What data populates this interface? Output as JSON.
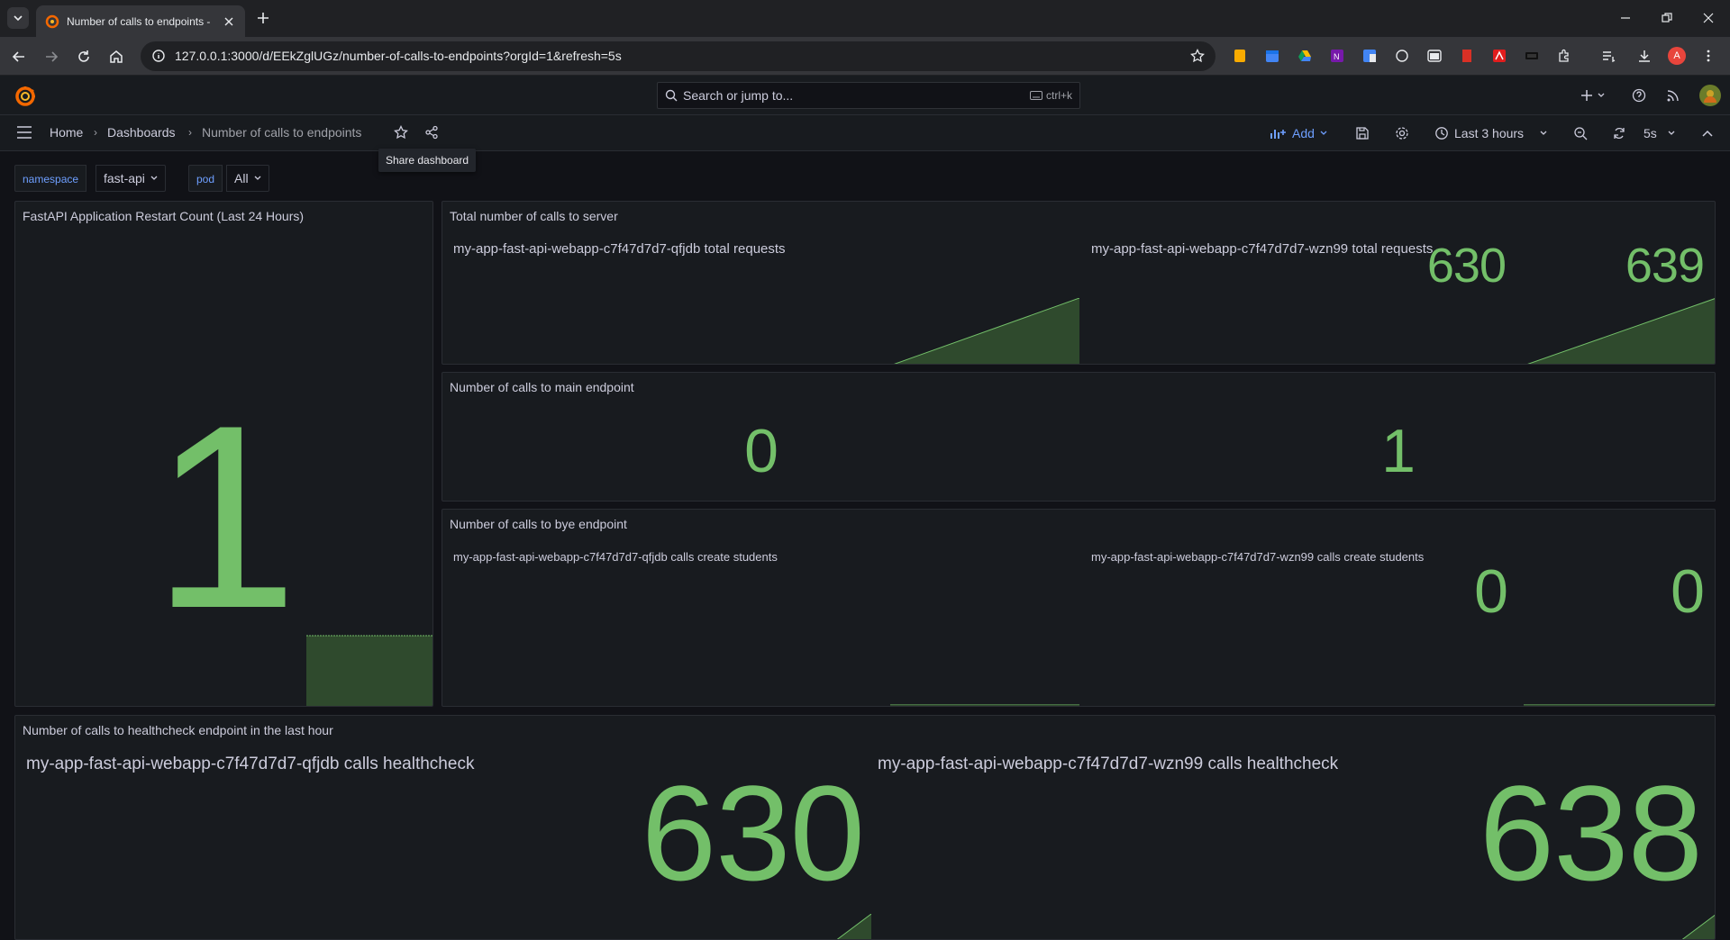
{
  "browser": {
    "tab_title": "Number of calls to endpoints -",
    "url": "127.0.0.1:3000/d/EEkZglUGz/number-of-calls-to-endpoints?orgId=1&refresh=5s",
    "profile_initial": "A"
  },
  "grafana_nav": {
    "search_placeholder": "Search or jump to...",
    "search_shortcut": "ctrl+k"
  },
  "breadcrumb": {
    "home": "Home",
    "dashboards": "Dashboards",
    "current": "Number of calls to endpoints",
    "share_tooltip": "Share dashboard"
  },
  "toolbar": {
    "add_label": "Add",
    "time_range": "Last 3 hours",
    "refresh_interval": "5s"
  },
  "variables": [
    {
      "label": "namespace",
      "value": "fast-api"
    },
    {
      "label": "pod",
      "value": "All"
    }
  ],
  "colors": {
    "stat_green": "#73bf69",
    "spark_fill": "#2f4a2d"
  },
  "panels": {
    "restart": {
      "title": "FastAPI Application Restart Count (Last 24 Hours)",
      "value": "1"
    },
    "total_calls": {
      "title": "Total number of calls to server",
      "items": [
        {
          "label": "my-app-fast-api-webapp-c7f47d7d7-qfjdb total requests",
          "value": "630"
        },
        {
          "label": "my-app-fast-api-webapp-c7f47d7d7-wzn99 total requests",
          "value": "639"
        }
      ]
    },
    "main_endpoint": {
      "title": "Number of calls to main endpoint",
      "items": [
        {
          "value": "0"
        },
        {
          "value": "1"
        }
      ]
    },
    "bye_endpoint": {
      "title": "Number of calls to bye endpoint",
      "items": [
        {
          "label": "my-app-fast-api-webapp-c7f47d7d7-qfjdb calls create students",
          "value": "0"
        },
        {
          "label": "my-app-fast-api-webapp-c7f47d7d7-wzn99 calls create students",
          "value": "0"
        }
      ]
    },
    "healthcheck": {
      "title": "Number of calls to healthcheck endpoint in the last hour",
      "items": [
        {
          "label": "my-app-fast-api-webapp-c7f47d7d7-qfjdb calls healthcheck",
          "value": "630"
        },
        {
          "label": "my-app-fast-api-webapp-c7f47d7d7-wzn99 calls healthcheck",
          "value": "638"
        }
      ]
    }
  }
}
